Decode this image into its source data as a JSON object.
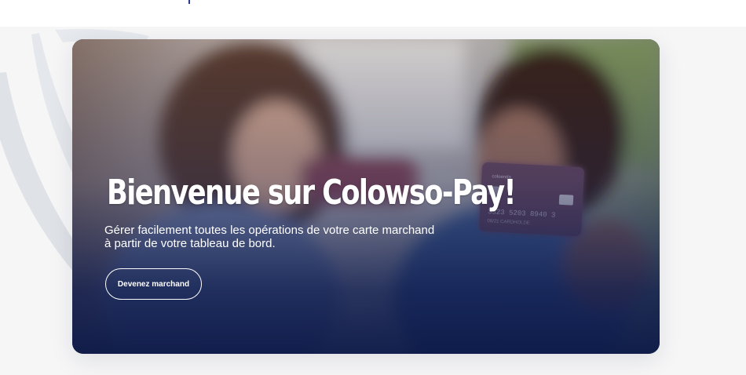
{
  "hero": {
    "title": "Bienvenue sur Colowso-Pay!",
    "subtitle": "Gérer facilement toutes les opérations de votre carte marchand\n à partir de votre tableau de bord.",
    "cta_label": "Devenez marchand",
    "photo_icon": "two-women-holding-credit-card-photo"
  },
  "card": {
    "number": "3323  5203  8940 3",
    "holder": "CARDHOLDE",
    "expiry": "08/21",
    "brand": "coloenda"
  },
  "colors": {
    "accent": "#1c2a6b",
    "overlay": "#0e1c4e",
    "background": "#f6f6f7",
    "decor_arc": "#d9dde3"
  }
}
